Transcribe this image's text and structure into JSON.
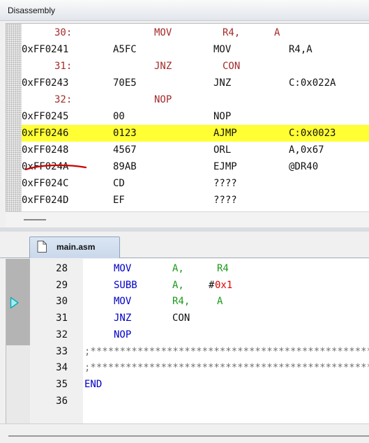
{
  "disassembly": {
    "title": "Disassembly",
    "rows": [
      {
        "type": "src",
        "line": "30:",
        "mnemonic": "MOV",
        "op1": "R4,",
        "op2": "A"
      },
      {
        "type": "asm",
        "addr": "0xFF0241",
        "code": "A5FC",
        "mnemonic": "MOV",
        "operand": "R4,A"
      },
      {
        "type": "src",
        "line": "31:",
        "mnemonic": "JNZ",
        "op1": "CON",
        "op2": ""
      },
      {
        "type": "asm",
        "addr": "0xFF0243",
        "code": "70E5",
        "mnemonic": "JNZ",
        "operand": "C:0x022A"
      },
      {
        "type": "src",
        "line": "32:",
        "mnemonic": "NOP",
        "op1": "",
        "op2": ""
      },
      {
        "type": "asm",
        "addr": "0xFF0245",
        "code": "00",
        "mnemonic": "NOP",
        "operand": ""
      },
      {
        "type": "asm",
        "addr": "0xFF0246",
        "code": "0123",
        "mnemonic": "AJMP",
        "operand": "C:0x0023",
        "highlight": true
      },
      {
        "type": "asm",
        "addr": "0xFF0248",
        "code": "4567",
        "mnemonic": "ORL",
        "operand": "A,0x67"
      },
      {
        "type": "asm",
        "addr": "0xFF024A",
        "code": "89AB",
        "mnemonic": "EJMP",
        "operand": "@DR40"
      },
      {
        "type": "asm",
        "addr": "0xFF024C",
        "code": "CD",
        "mnemonic": "????",
        "operand": ""
      },
      {
        "type": "asm",
        "addr": "0xFF024D",
        "code": "EF",
        "mnemonic": "????",
        "operand": ""
      }
    ],
    "highlight_color": "#ffff33",
    "annotation_color": "#cc0000"
  },
  "editor": {
    "tab_label": "main.asm",
    "current_line": 30,
    "lines": [
      {
        "num": "28",
        "kind": "instr",
        "mnemonic": "MOV",
        "a": "A,",
        "b": "R4",
        "b_kind": "reg"
      },
      {
        "num": "29",
        "kind": "instr",
        "mnemonic": "SUBB",
        "a": "A,",
        "hash": "#",
        "b": "0x1",
        "b_kind": "num"
      },
      {
        "num": "30",
        "kind": "instr",
        "mnemonic": "MOV",
        "a": "R4,",
        "b": "A",
        "b_kind": "reg"
      },
      {
        "num": "31",
        "kind": "instr",
        "mnemonic": "JNZ",
        "a": "CON",
        "a_kind": "plain",
        "b": ""
      },
      {
        "num": "32",
        "kind": "instr",
        "mnemonic": "NOP",
        "a": "",
        "b": ""
      },
      {
        "num": "33",
        "kind": "comment",
        "text": ";**************************************************"
      },
      {
        "num": "34",
        "kind": "comment",
        "text": ";**************************************************"
      },
      {
        "num": "35",
        "kind": "end",
        "text": "END"
      },
      {
        "num": "36",
        "kind": "blank"
      }
    ]
  }
}
